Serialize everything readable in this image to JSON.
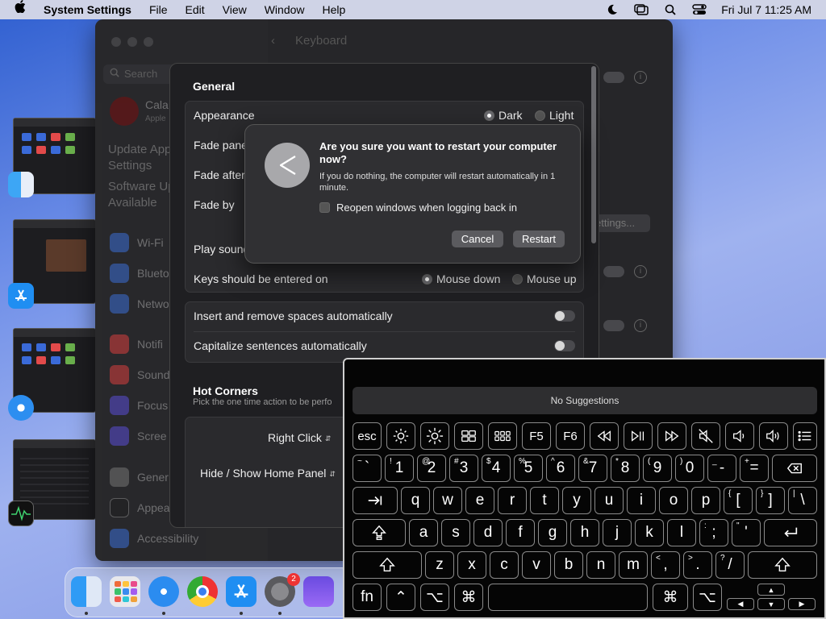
{
  "menubar": {
    "app_name": "System Settings",
    "menus": [
      "File",
      "Edit",
      "View",
      "Window",
      "Help"
    ],
    "clock": "Fri Jul 7  11:25 AM"
  },
  "window": {
    "title": "Keyboard",
    "search_placeholder": "Search",
    "account_name": "Cala",
    "account_sub": "Apple",
    "update_line1": "Update Apple",
    "update_line2": "Settings",
    "update_line3": "Software Up",
    "update_line4": "Available",
    "sidebar_items": [
      "Wi-Fi",
      "Blueto",
      "Netwo",
      "Notifi",
      "Sound",
      "Focus",
      "Scree",
      "Gener",
      "Appea",
      "Accessibility"
    ],
    "settings_button": "ettings..."
  },
  "sheet": {
    "section_general": "General",
    "appearance_label": "Appearance",
    "appearance_dark": "Dark",
    "appearance_light": "Light",
    "fade_panel_label": "Fade pane",
    "fade_after_label": "Fade after",
    "fade_by_label": "Fade by",
    "play_sound_label": "Play sound",
    "keys_entered_label": "Keys should be entered on",
    "mouse_down": "Mouse down",
    "mouse_up": "Mouse up",
    "insert_spaces_label": "Insert and remove spaces automatically",
    "capitalize_label": "Capitalize sentences automatically",
    "section_hot_corners": "Hot Corners",
    "hot_corners_desc": "Pick the one time action to be perfo",
    "right_click": "Right Click",
    "hide_show_home": "Hide / Show Home Panel"
  },
  "alert": {
    "title": "Are you sure you want to restart your computer now?",
    "message": "If you do nothing, the computer will restart automatically in 1 minute.",
    "checkbox_label": "Reopen windows when logging back in",
    "cancel": "Cancel",
    "restart": "Restart"
  },
  "keyboard": {
    "suggestions": "No Suggestions",
    "row_fn": [
      "esc",
      "F5",
      "F6"
    ],
    "row_num": [
      {
        "main": "`",
        "shift": "~"
      },
      {
        "main": "1",
        "shift": "!"
      },
      {
        "main": "2",
        "shift": "@"
      },
      {
        "main": "3",
        "shift": "#"
      },
      {
        "main": "4",
        "shift": "$"
      },
      {
        "main": "5",
        "shift": "%"
      },
      {
        "main": "6",
        "shift": "^"
      },
      {
        "main": "7",
        "shift": "&"
      },
      {
        "main": "8",
        "shift": "*"
      },
      {
        "main": "9",
        "shift": "("
      },
      {
        "main": "0",
        "shift": ")"
      },
      {
        "main": "-",
        "shift": "_"
      },
      {
        "main": "=",
        "shift": "+"
      }
    ],
    "row_q": [
      "q",
      "w",
      "e",
      "r",
      "t",
      "y",
      "u",
      "i",
      "o",
      "p"
    ],
    "row_q_extra": [
      {
        "main": "[",
        "shift": "{"
      },
      {
        "main": "]",
        "shift": "}"
      },
      {
        "main": "\\",
        "shift": "|"
      }
    ],
    "row_a": [
      "a",
      "s",
      "d",
      "f",
      "g",
      "h",
      "j",
      "k",
      "l"
    ],
    "row_a_extra": [
      {
        "main": ";",
        "shift": ":"
      },
      {
        "main": "'",
        "shift": "\""
      }
    ],
    "row_z": [
      "z",
      "x",
      "c",
      "v",
      "b",
      "n",
      "m"
    ],
    "row_z_extra": [
      {
        "main": ",",
        "shift": "<"
      },
      {
        "main": ".",
        "shift": ">"
      },
      {
        "main": "/",
        "shift": "?"
      }
    ],
    "fn_label": "fn"
  },
  "colors": {
    "accent": "#3c6fd6",
    "window_bg": "#262629",
    "keyboard_bg": "#050505"
  }
}
